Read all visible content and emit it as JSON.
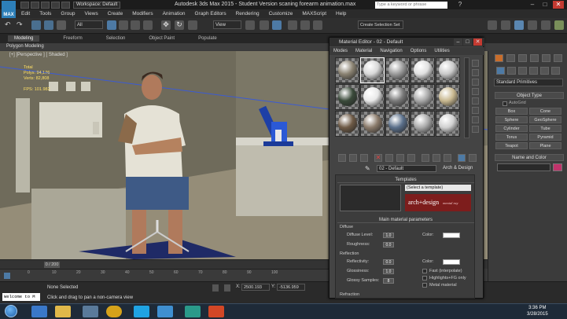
{
  "titlebar": {
    "app_badge": "MAX",
    "workspace": "Workspace: Default",
    "title": "Autodesk 3ds Max  2015  - Student Version    scaning forearm animation.max",
    "search_placeholder": "Type a keyword or phrase"
  },
  "menu": [
    "Edit",
    "Tools",
    "Group",
    "Views",
    "Create",
    "Modifiers",
    "Animation",
    "Graph Editors",
    "Rendering",
    "Customize",
    "MAXScript",
    "Help"
  ],
  "toolbar": {
    "filter": "All",
    "view": "View",
    "selection_set": "Create Selection Set"
  },
  "ribbon": {
    "tabs": [
      "Modeling",
      "Freeform",
      "Selection",
      "Object Paint",
      "Populate"
    ],
    "panel": "Polygon Modeling"
  },
  "viewport": {
    "label": "[+] [Perspective ] [ Shaded ]",
    "stats": {
      "total": "Total",
      "polys": "Polys:  94,176",
      "verts": "Verts:  82,808",
      "fps": "FPS:   101.982"
    }
  },
  "timeline": {
    "frame": "0 / 200",
    "ticks": [
      "0",
      "10",
      "20",
      "30",
      "40",
      "50",
      "60",
      "70",
      "80",
      "90",
      "100"
    ]
  },
  "status": {
    "maxscript": "Welcome to M",
    "selection": "None Selected",
    "hint": "Click and drag to pan a non-camera view",
    "x": "2500.193",
    "y": "-5136.959"
  },
  "command_panel": {
    "category": "Standard Primitives",
    "object_type": "Object Type",
    "autogrid": "AutoGrid",
    "buttons": [
      "Box",
      "Cone",
      "Sphere",
      "GeoSphere",
      "Cylinder",
      "Tube",
      "Torus",
      "Pyramid",
      "Teapot",
      "Plane"
    ],
    "name_color": "Name and Color",
    "accent_color": "#c0336b"
  },
  "material_editor": {
    "title": "Material Editor - 02 - Default",
    "menu": [
      "Modes",
      "Material",
      "Navigation",
      "Options",
      "Utilities"
    ],
    "material_name": "02 - Default",
    "material_type": "Arch & Design",
    "templates_header": "Templates",
    "template_select": "(Select a template)",
    "logo": "arch+design",
    "logo_sub": "mental ray",
    "main_header": "Main material parameters",
    "diffuse": {
      "section": "Diffuse",
      "level_label": "Diffuse Level:",
      "level": "1.0",
      "rough_label": "Roughness:",
      "rough": "0.0",
      "color_label": "Color:"
    },
    "reflection": {
      "section": "Reflection",
      "refl_label": "Reflectivity:",
      "refl": "0.0",
      "gloss_label": "Glossiness:",
      "gloss": "1.0",
      "samples_label": "Glossy Samples:",
      "samples": "8",
      "color_label": "Color:",
      "fast": "Fast (interpolate)",
      "highlights": "Highlights+FG only",
      "metal": "Metal material"
    },
    "refraction": "Refraction"
  },
  "taskbar": {
    "time": "3:36 PM",
    "date": "3/28/2015"
  }
}
